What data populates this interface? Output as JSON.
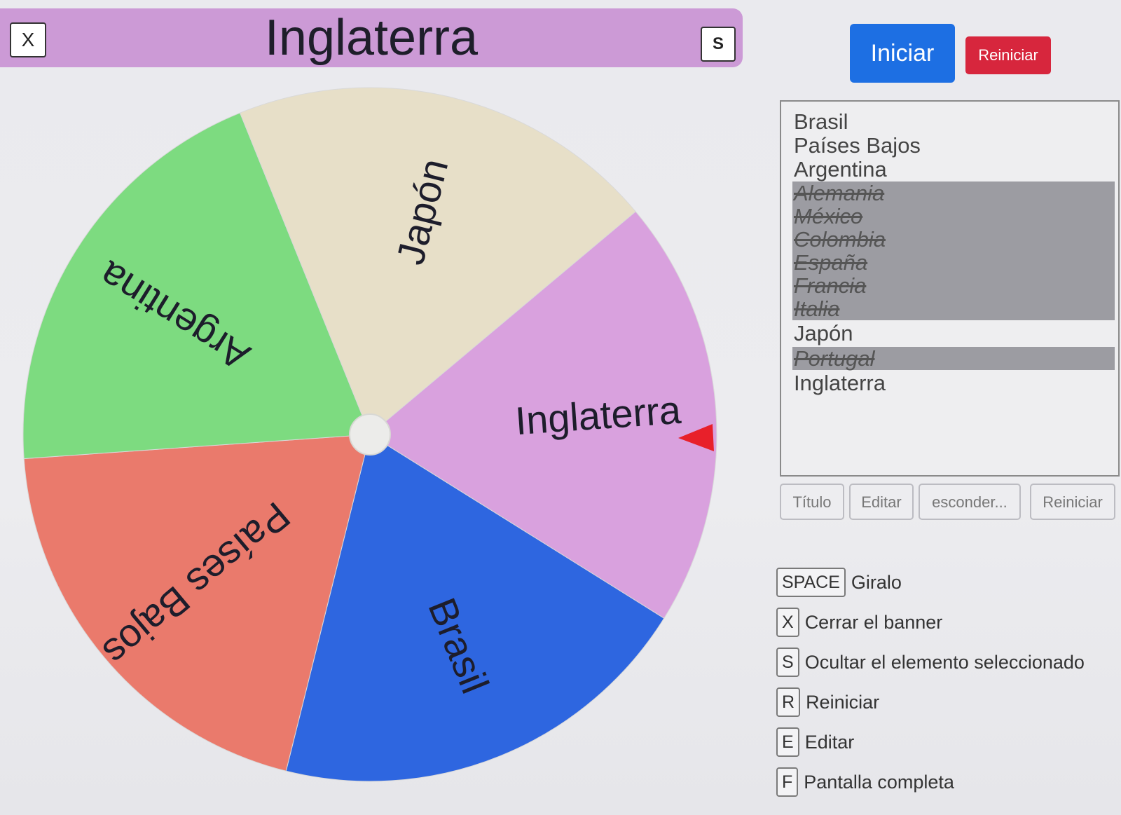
{
  "banner": {
    "close_label": "X",
    "title": "Inglaterra",
    "hide_label": "S",
    "color": "#cc9ad6"
  },
  "controls": {
    "start_label": "Iniciar",
    "reset_label": "Reiniciar"
  },
  "wheel": {
    "segments": [
      {
        "label": "Inglaterra",
        "color": "#d9a1de"
      },
      {
        "label": "Brasil",
        "color": "#2e66e0"
      },
      {
        "label": "Países Bajos",
        "color": "#ea7a6c"
      },
      {
        "label": "Argentina",
        "color": "#7ddb80"
      },
      {
        "label": "Japón",
        "color": "#e7dfc8"
      }
    ],
    "pointer_color": "#e8202a"
  },
  "entries": [
    {
      "label": "Brasil",
      "struck": false
    },
    {
      "label": "Países Bajos",
      "struck": false
    },
    {
      "label": "Argentina",
      "struck": false
    },
    {
      "label": "Alemania",
      "struck": true
    },
    {
      "label": "México",
      "struck": true
    },
    {
      "label": "Colombia",
      "struck": true
    },
    {
      "label": "España",
      "struck": true
    },
    {
      "label": "Francia",
      "struck": true
    },
    {
      "label": "Italia",
      "struck": true
    },
    {
      "label": "Japón",
      "struck": false
    },
    {
      "label": "Portugal",
      "struck": true
    },
    {
      "label": "Inglaterra",
      "struck": false
    }
  ],
  "toolbar": {
    "title_label": "Título",
    "edit_label": "Editar",
    "hide_label": "esconder...",
    "reset_label": "Reiniciar"
  },
  "shortcuts": [
    {
      "key": "SPACE",
      "action": "Giralo"
    },
    {
      "key": "X",
      "action": "Cerrar el banner"
    },
    {
      "key": "S",
      "action": "Ocultar el elemento seleccionado"
    },
    {
      "key": "R",
      "action": "Reiniciar"
    },
    {
      "key": "E",
      "action": "Editar"
    },
    {
      "key": "F",
      "action": "Pantalla completa"
    }
  ]
}
